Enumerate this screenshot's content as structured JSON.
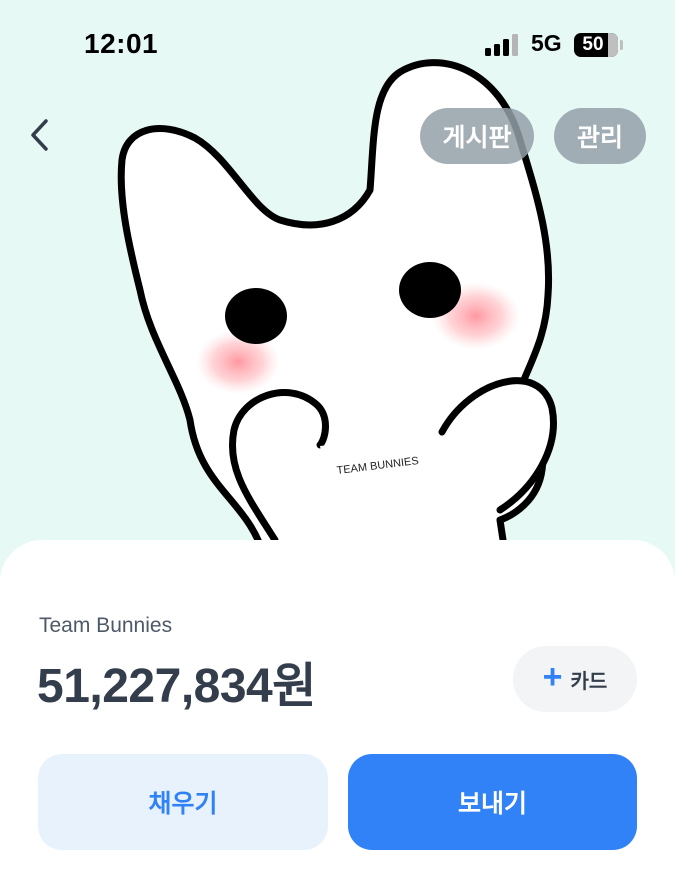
{
  "status_bar": {
    "time": "12:01",
    "network": "5G",
    "battery": "50",
    "signal_icon": "cellular-signal-icon",
    "battery_icon": "battery-icon"
  },
  "header": {
    "back_icon": "chevron-left-icon",
    "board_label": "게시판",
    "manage_label": "관리"
  },
  "hero": {
    "illustration": "white bunny holding a sign",
    "sign_text": "TEAM BUNNIES"
  },
  "account": {
    "name": "Team Bunnies",
    "balance": "51,227,834원"
  },
  "add_card": {
    "icon": "plus-icon",
    "label": "카드"
  },
  "actions": {
    "fill_label": "채우기",
    "send_label": "보내기"
  },
  "colors": {
    "hero_background": "#e6f9f5",
    "accent": "#3182f6",
    "accent_light": "#e8f2fd",
    "text_primary": "#333d4b",
    "text_secondary": "#4e5968",
    "pill_gray": "#94a0a8",
    "cheek_pink": "#ff8c96"
  }
}
